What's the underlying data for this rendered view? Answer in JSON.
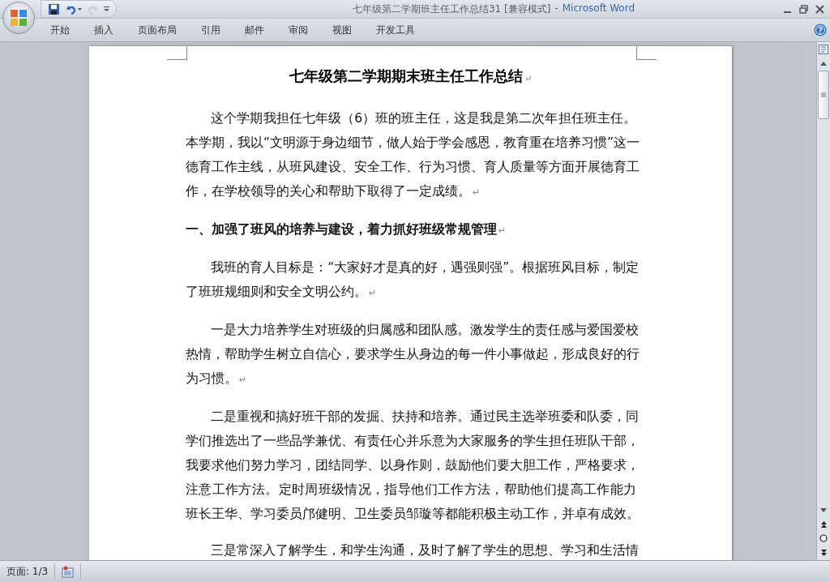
{
  "window": {
    "title": "七年级第二学期班主任工作总结31 [兼容模式]",
    "separator": "-",
    "app_name": "Microsoft Word"
  },
  "quick_access": [
    {
      "kind": "save",
      "disabled": false
    },
    {
      "kind": "undo",
      "disabled": false
    },
    {
      "kind": "redo",
      "disabled": true
    }
  ],
  "ribbon_tabs": [
    {
      "label": "开始",
      "selected": false
    },
    {
      "label": "插入",
      "selected": false
    },
    {
      "label": "页面布局",
      "selected": false
    },
    {
      "label": "引用",
      "selected": false
    },
    {
      "label": "邮件",
      "selected": false
    },
    {
      "label": "审阅",
      "selected": false
    },
    {
      "label": "视图",
      "selected": false
    },
    {
      "label": "开发工具",
      "selected": false
    }
  ],
  "document": {
    "title": "七年级第二学期期末班主任工作总结",
    "title_mark": "↵",
    "paragraphs": [
      {
        "kind": "body",
        "end_mark": "↵",
        "lines": [
          "这个学期我担任七年级（6）班的班主任，这是我是第二次年担任班主任。",
          "本学期，我以“文明源于身边细节，做人始于学会感恩，教育重在培养习惯”这一",
          "德育工作主线，从班风建设、安全工作、行为习惯、育人质量等方面开展德育工",
          "作，在学校领导的关心和帮助下取得了一定成绩。"
        ]
      },
      {
        "kind": "heading",
        "end_mark": "↵",
        "lines": [
          "一、加强了班风的培养与建设，着力抓好班级常规管理"
        ]
      },
      {
        "kind": "body",
        "end_mark": "↵",
        "lines": [
          "我班的育人目标是：“大家好才是真的好，遇强则强”。根据班风目标，制定",
          "了班班规细则和安全文明公约。"
        ]
      },
      {
        "kind": "body",
        "end_mark": "↵",
        "lines": [
          "一是大力培养学生对班级的归属感和团队感。激发学生的责任感与爱国爱校",
          "热情，帮助学生树立自信心，要求学生从身边的每一件小事做起，形成良好的行",
          "为习惯。"
        ]
      },
      {
        "kind": "body",
        "lines": [
          "二是重视和搞好班干部的发掘、扶持和培养。通过民主选举班委和队委，同",
          "学们推选出了一些品学兼优、有责任心并乐意为大家服务的学生担任班队干部，",
          "我要求他们努力学习，团结同学、以身作则，鼓励他们要大胆工作，严格要求，",
          "注意工作方法。定时周班级情况，指导他们工作方法，帮助他们提高工作能力",
          "班长王华、学习委员邝健明、卫生委员邹璇等都能积极主动工作，并卓有成效。"
        ]
      },
      {
        "kind": "body",
        "lines": [
          "三是常深入了解学生，和学生沟通，及时了解了学生的思想、学习和生活情"
        ]
      }
    ]
  },
  "status_bar": {
    "page": "页面: 1/3"
  }
}
